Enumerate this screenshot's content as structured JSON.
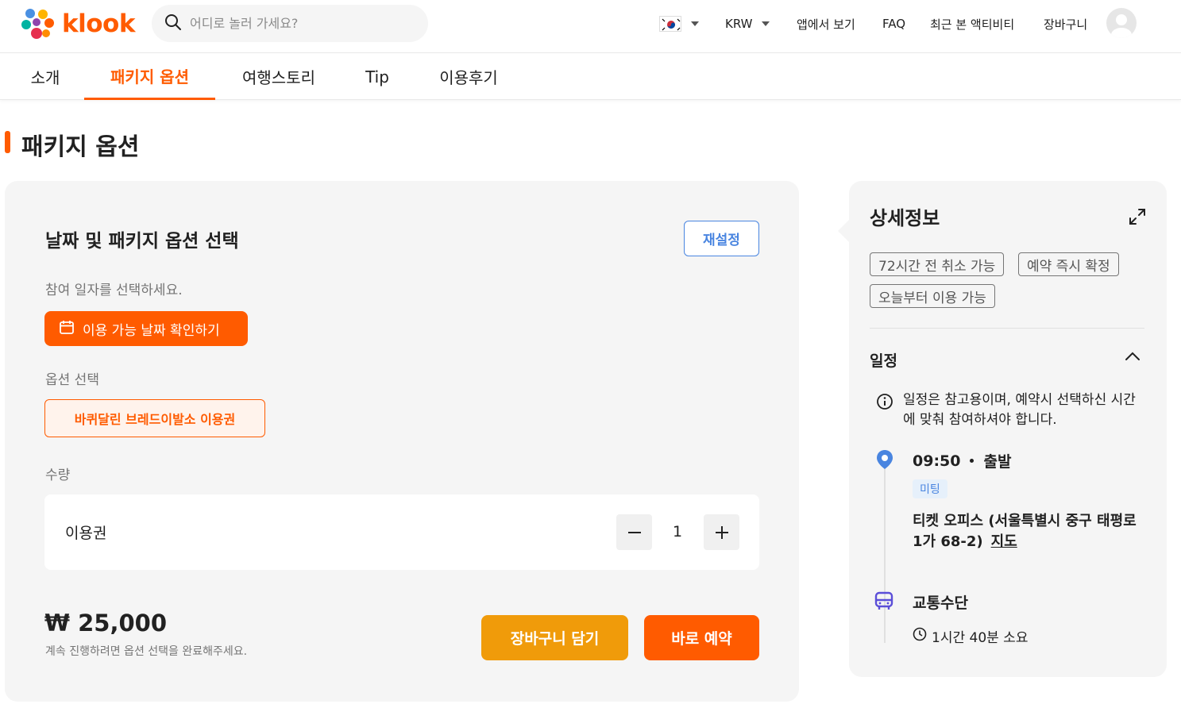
{
  "header": {
    "brand": "klook",
    "search_placeholder": "어디로 놀러 가세요?",
    "currency": "KRW",
    "nav": [
      "앱에서 보기",
      "FAQ",
      "최근 본 액티비티",
      "장바구니"
    ]
  },
  "tabs": [
    {
      "label": "소개",
      "active": false
    },
    {
      "label": "패키지 옵션",
      "active": true
    },
    {
      "label": "여행스토리",
      "active": false
    },
    {
      "label": "Tip",
      "active": false
    },
    {
      "label": "이용후기",
      "active": false
    }
  ],
  "section_title": "패키지 옵션",
  "booking": {
    "title": "날짜 및 패키지 옵션 선택",
    "reset_label": "재설정",
    "date_prompt": "참여 일자를 선택하세요.",
    "date_button": "이용 가능 날짜 확인하기",
    "option_label": "옵션 선택",
    "option_value": "바퀴달린 브레드이발소 이용권",
    "quantity_label": "수량",
    "quantity_item": "이용권",
    "quantity_value": "1",
    "price": "₩ 25,000",
    "price_note": "계속 진행하려면 옵션 선택을 완료해주세요.",
    "cart_button": "장바구니 담기",
    "book_button": "바로 예약"
  },
  "details": {
    "title": "상세정보",
    "tags": [
      "72시간 전 취소 가능",
      "예약 즉시 확정",
      "오늘부터 이용 가능"
    ],
    "schedule_title": "일정",
    "schedule_note": "일정은 참고용이며, 예약시 선택하신 시간에 맞춰 참여하셔야 합니다.",
    "departure_time": "09:50",
    "departure_label": "출발",
    "meeting_badge": "미팅",
    "address": "티켓 오피스 (서울특별시 중구 태평로1가 68-2)",
    "map_link": "지도",
    "transport_label": "교통수단",
    "duration": "1시간 40분 소요"
  },
  "colors": {
    "accent": "#ff5b00",
    "cart": "#f09b0a",
    "link_blue": "#4985e0",
    "panel_bg": "#f5f5f5"
  }
}
